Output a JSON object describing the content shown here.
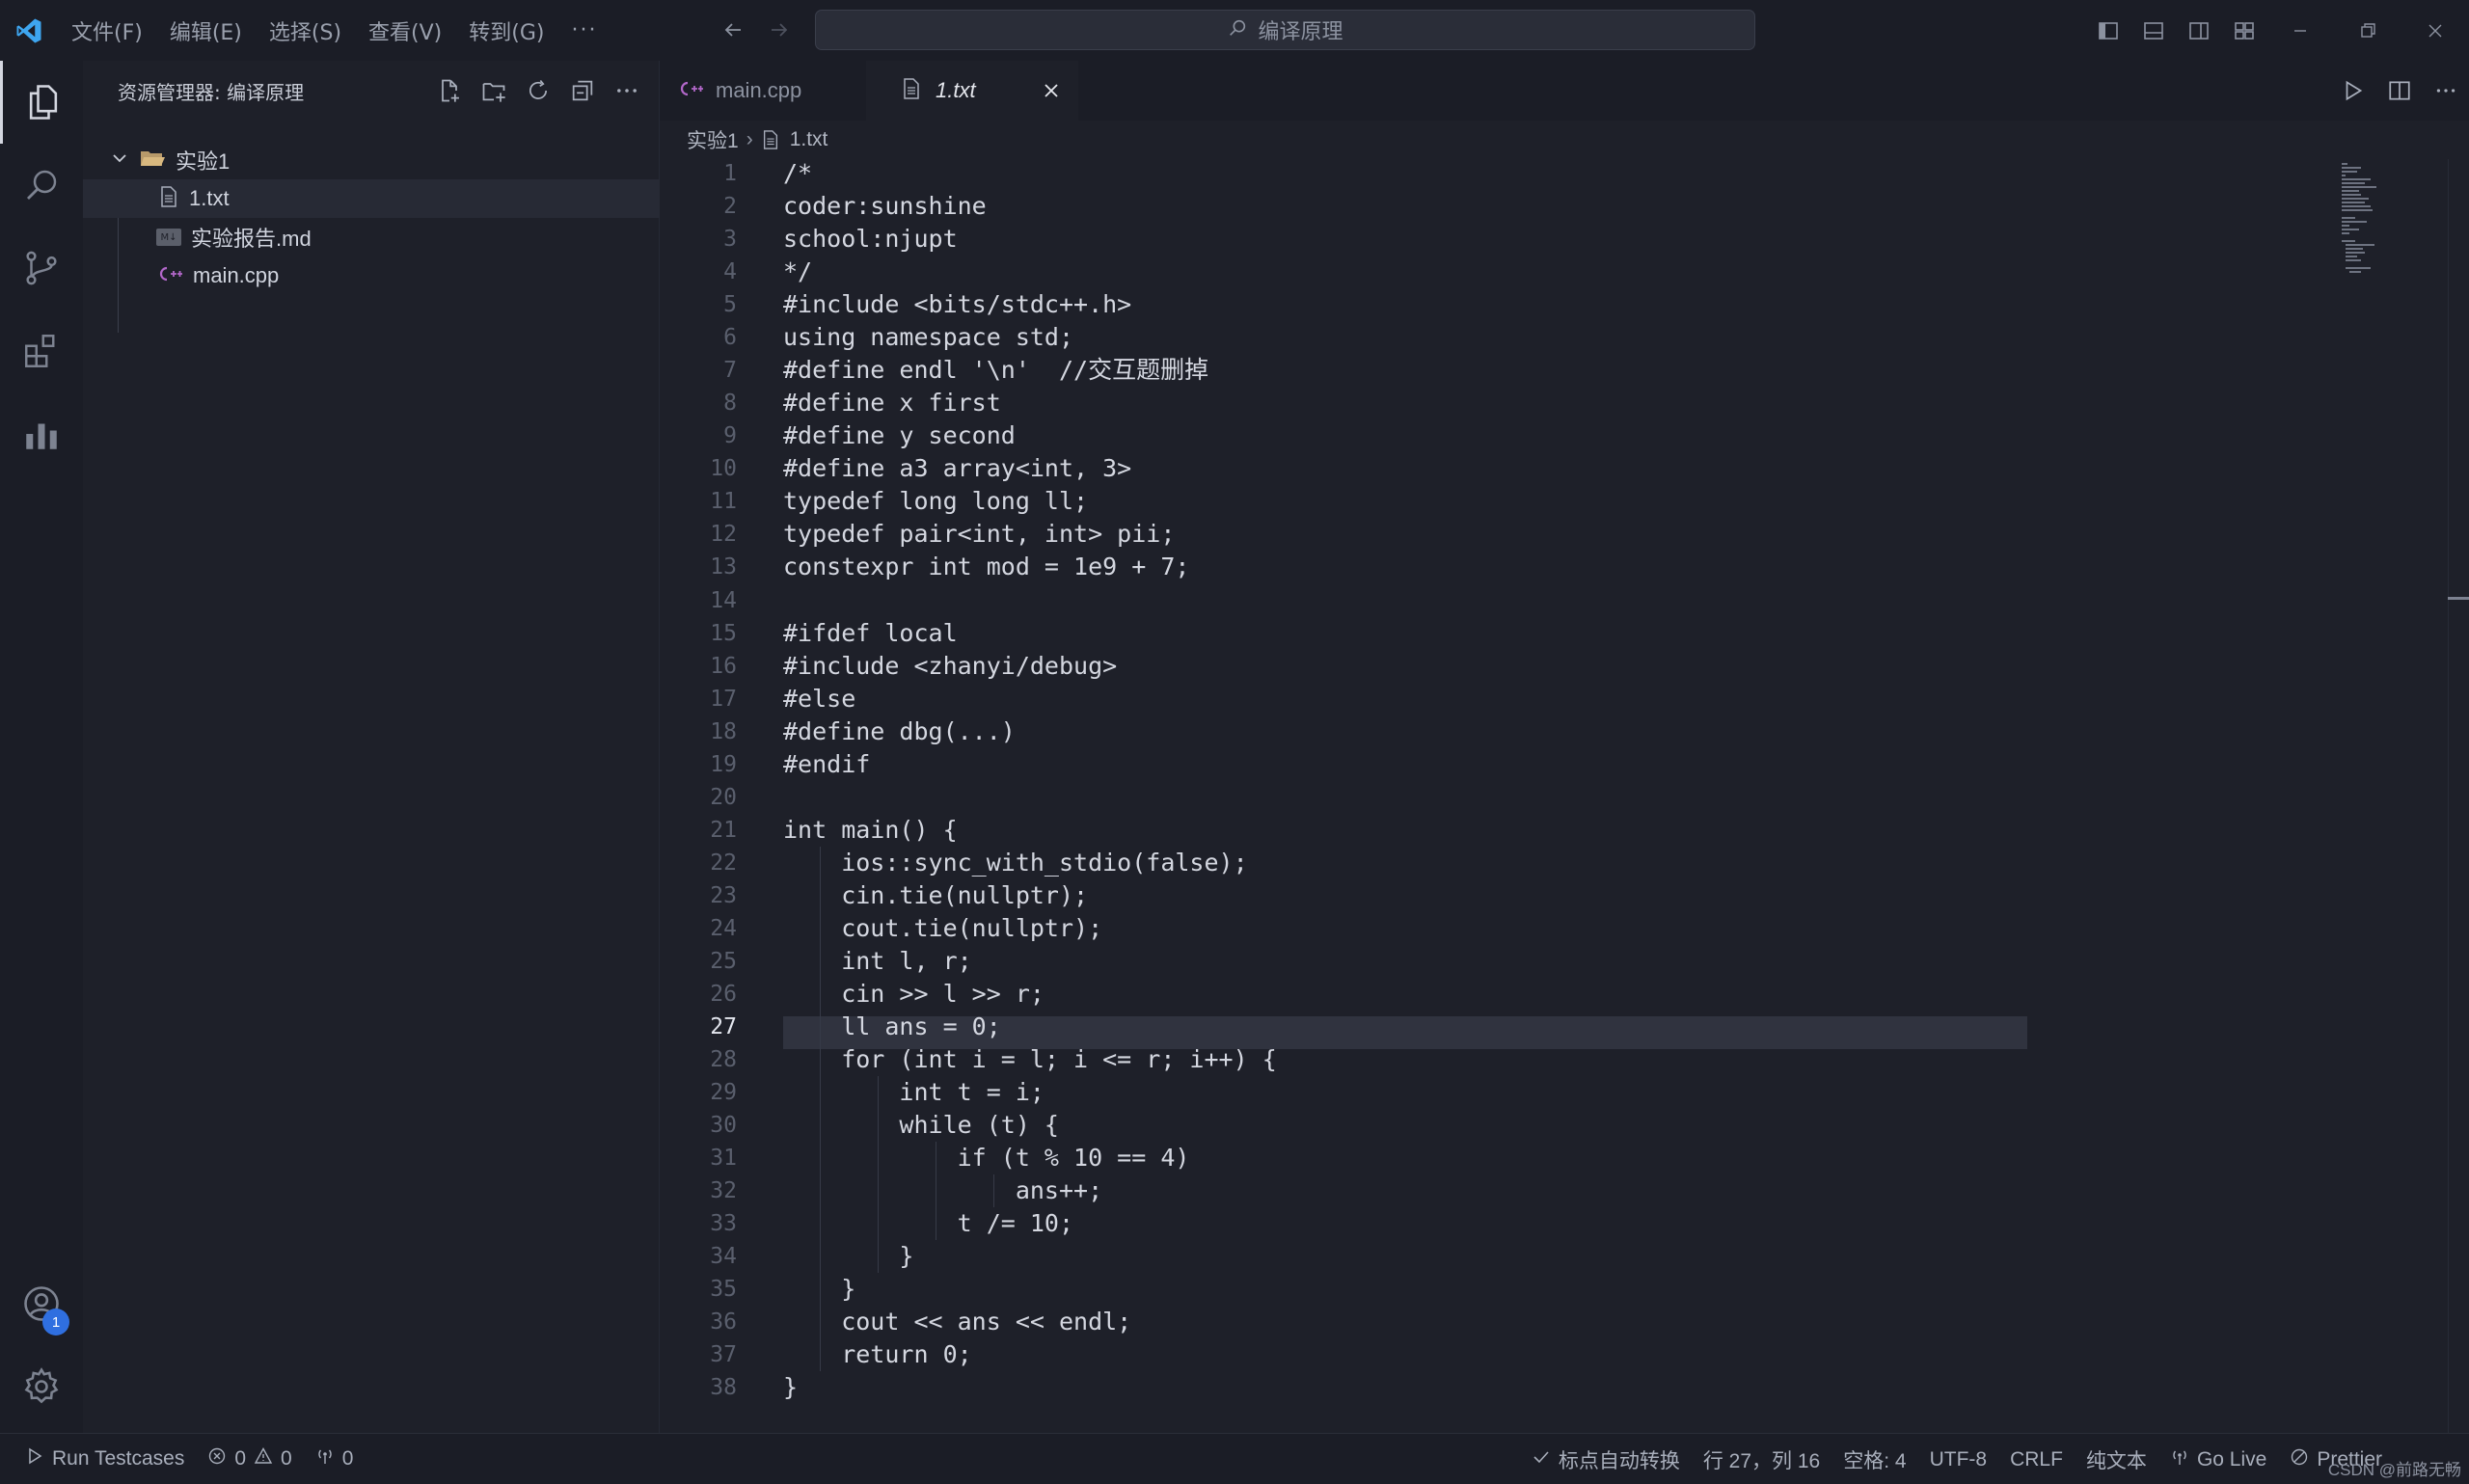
{
  "app": {
    "menu": [
      "文件(F)",
      "编辑(E)",
      "选择(S)",
      "查看(V)",
      "转到(G)"
    ],
    "menu_more": "···",
    "search_text": "编译原理"
  },
  "activity_bar": {
    "items": [
      "explorer-icon",
      "search-icon",
      "source-control-icon",
      "extensions-icon",
      "charts-icon"
    ],
    "account_badge": "1"
  },
  "sidebar": {
    "title": "资源管理器: 编译原理",
    "folder": "实验1",
    "files": [
      "1.txt",
      "实验报告.md",
      "main.cpp"
    ],
    "md_icon_label": "M↓"
  },
  "tabs": [
    {
      "label": "main.cpp",
      "active": false
    },
    {
      "label": "1.txt",
      "active": true
    }
  ],
  "breadcrumb": {
    "folder": "实验1",
    "separator": "›",
    "file": "1.txt"
  },
  "editor": {
    "active_line": 27,
    "lines": [
      "/*",
      "coder:sunshine",
      "school:njupt",
      "*/",
      "#include <bits/stdc++.h>",
      "using namespace std;",
      "#define endl '\\n'  //交互题删掉",
      "#define x first",
      "#define y second",
      "#define a3 array<int, 3>",
      "typedef long long ll;",
      "typedef pair<int, int> pii;",
      "constexpr int mod = 1e9 + 7;",
      "",
      "#ifdef local",
      "#include <zhanyi/debug>",
      "#else",
      "#define dbg(...)",
      "#endif",
      "",
      "int main() {",
      "    ios::sync_with_stdio(false);",
      "    cin.tie(nullptr);",
      "    cout.tie(nullptr);",
      "    int l, r;",
      "    cin >> l >> r;",
      "    ll ans = 0;",
      "    for (int i = l; i <= r; i++) {",
      "        int t = i;",
      "        while (t) {",
      "            if (t % 10 == 4)",
      "                ans++;",
      "            t /= 10;",
      "        }",
      "    }",
      "    cout << ans << endl;",
      "    return 0;",
      "}"
    ]
  },
  "status_bar": {
    "run": "Run Testcases",
    "errors": "0",
    "warnings": "0",
    "ports": "0",
    "punctuation": "标点自动转换",
    "position": "行 27，列 16",
    "spaces": "空格: 4",
    "encoding": "UTF-8",
    "eol": "CRLF",
    "language": "纯文本",
    "golive": "Go Live",
    "prettier": "Prettier",
    "watermark": "CSDN @前路无畅"
  },
  "colors": {
    "background": "#1e2029",
    "chrome": "#1b1d26",
    "accent": "#2f6fe0",
    "cpp_icon": "#b267c9"
  }
}
